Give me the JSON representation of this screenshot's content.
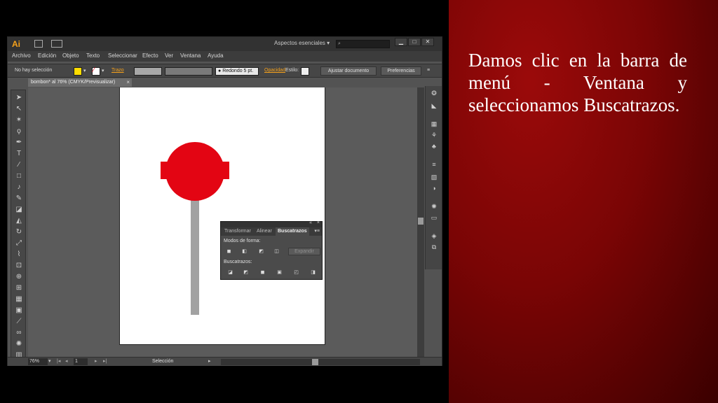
{
  "slide": {
    "text": "Damos clic en la barra de menú - Ventana y seleccionamos Buscatrazos."
  },
  "app": {
    "logo": "Ai",
    "workspace": "Aspectos esenciales",
    "menu": [
      "Archivo",
      "Edición",
      "Objeto",
      "Texto",
      "Seleccionar",
      "Efecto",
      "Ver",
      "Ventana",
      "Ayuda"
    ],
    "control": {
      "selection": "No hay selección",
      "stroke_label": "Trazo",
      "brush": "Redondo 5 pt.",
      "opacity_label": "Opacidad",
      "style_label": "Estilo:",
      "align_button": "Ajustar documento",
      "prefs_button": "Preferencias"
    },
    "document_tab": "bombon* al 76% (CMYK/Previsualizar)",
    "status": {
      "zoom": "76%",
      "page": "1",
      "tool": "Selección"
    },
    "pathfinder": {
      "tabs": [
        "Transformar",
        "Alinear",
        "Buscatrazos"
      ],
      "shape_modes_label": "Modos de forma:",
      "pathfinders_label": "Buscatrazos:",
      "expand_button": "Expandir"
    }
  },
  "colors": {
    "fill": "#ffdd00",
    "lollipop": "#e30513",
    "stick": "#a2a2a2"
  }
}
